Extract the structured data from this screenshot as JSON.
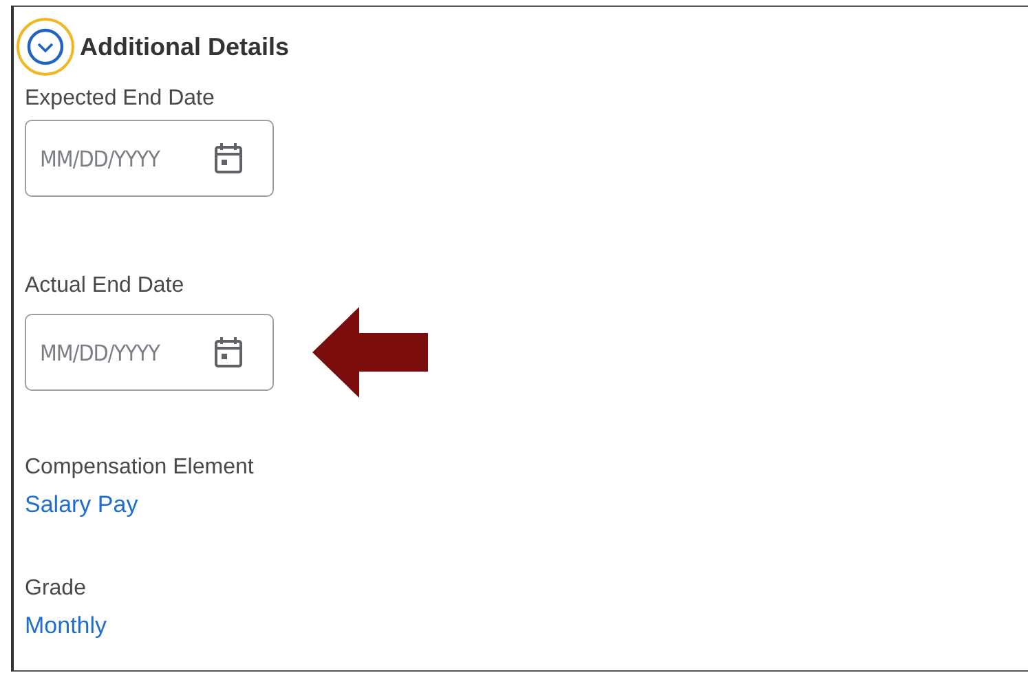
{
  "section": {
    "title": "Additional Details",
    "expanded": true,
    "focused": true
  },
  "fields": [
    {
      "kind": "date",
      "label": "Expected End Date",
      "placeholder": "MM/DD/YYYY",
      "highlighted": false
    },
    {
      "kind": "date",
      "label": "Actual End Date",
      "placeholder": "MM/DD/YYYY",
      "highlighted": true
    },
    {
      "kind": "link",
      "label": "Compensation Element",
      "value": "Salary Pay",
      "highlighted": false
    },
    {
      "kind": "link",
      "label": "Grade",
      "value": "Monthly",
      "highlighted": false
    }
  ]
}
